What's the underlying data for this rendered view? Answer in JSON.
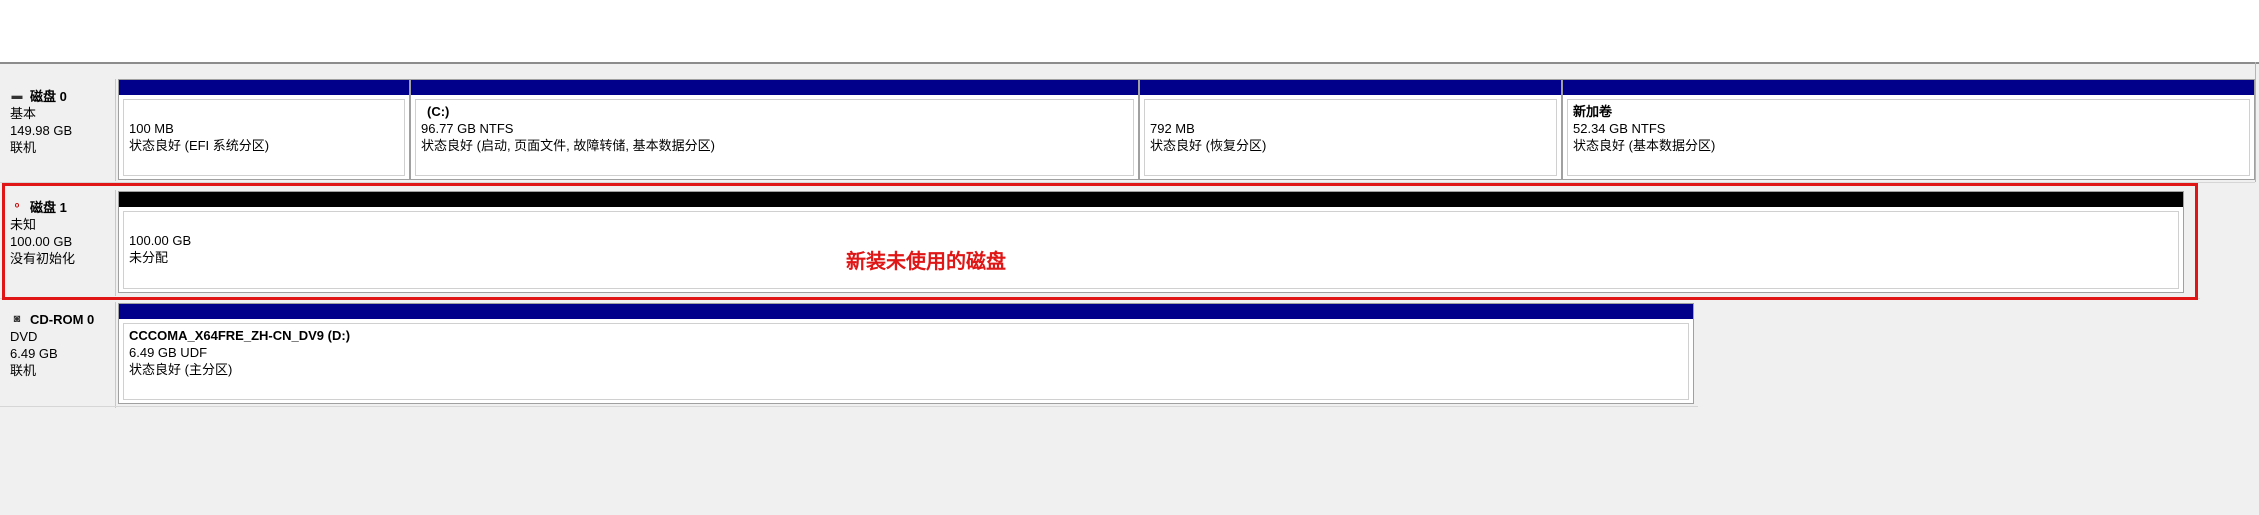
{
  "disks": [
    {
      "name": "磁盘 0",
      "type": "基本",
      "size": "149.98 GB",
      "status": "联机",
      "icon": "disk-icon",
      "partitions": [
        {
          "name": "",
          "size": "100 MB",
          "status": "状态良好 (EFI 系统分区)"
        },
        {
          "name": "(C:)",
          "size": "96.77 GB NTFS",
          "status": "状态良好 (启动, 页面文件, 故障转储, 基本数据分区)"
        },
        {
          "name": "",
          "size": "792 MB",
          "status": "状态良好 (恢复分区)"
        },
        {
          "name": "新加卷",
          "size": "52.34 GB NTFS",
          "status": "状态良好 (基本数据分区)"
        }
      ]
    },
    {
      "name": "磁盘 1",
      "type": "未知",
      "size": "100.00 GB",
      "status": "没有初始化",
      "icon": "disk-not-initialized-icon",
      "partitions": [
        {
          "name": "",
          "size": "100.00 GB",
          "status": "未分配"
        }
      ]
    },
    {
      "name": "CD-ROM 0",
      "type": "DVD",
      "size": "6.49 GB",
      "status": "联机",
      "icon": "cdrom-icon",
      "partitions": [
        {
          "name": "CCCOMA_X64FRE_ZH-CN_DV9  (D:)",
          "size": "6.49 GB UDF",
          "status": "状态良好 (主分区)"
        }
      ]
    }
  ],
  "annotation": "新装未使用的磁盘",
  "colors": {
    "primary_partition_bar": "#00008b",
    "unallocated_bar": "#000000",
    "annotation": "#e01515"
  }
}
